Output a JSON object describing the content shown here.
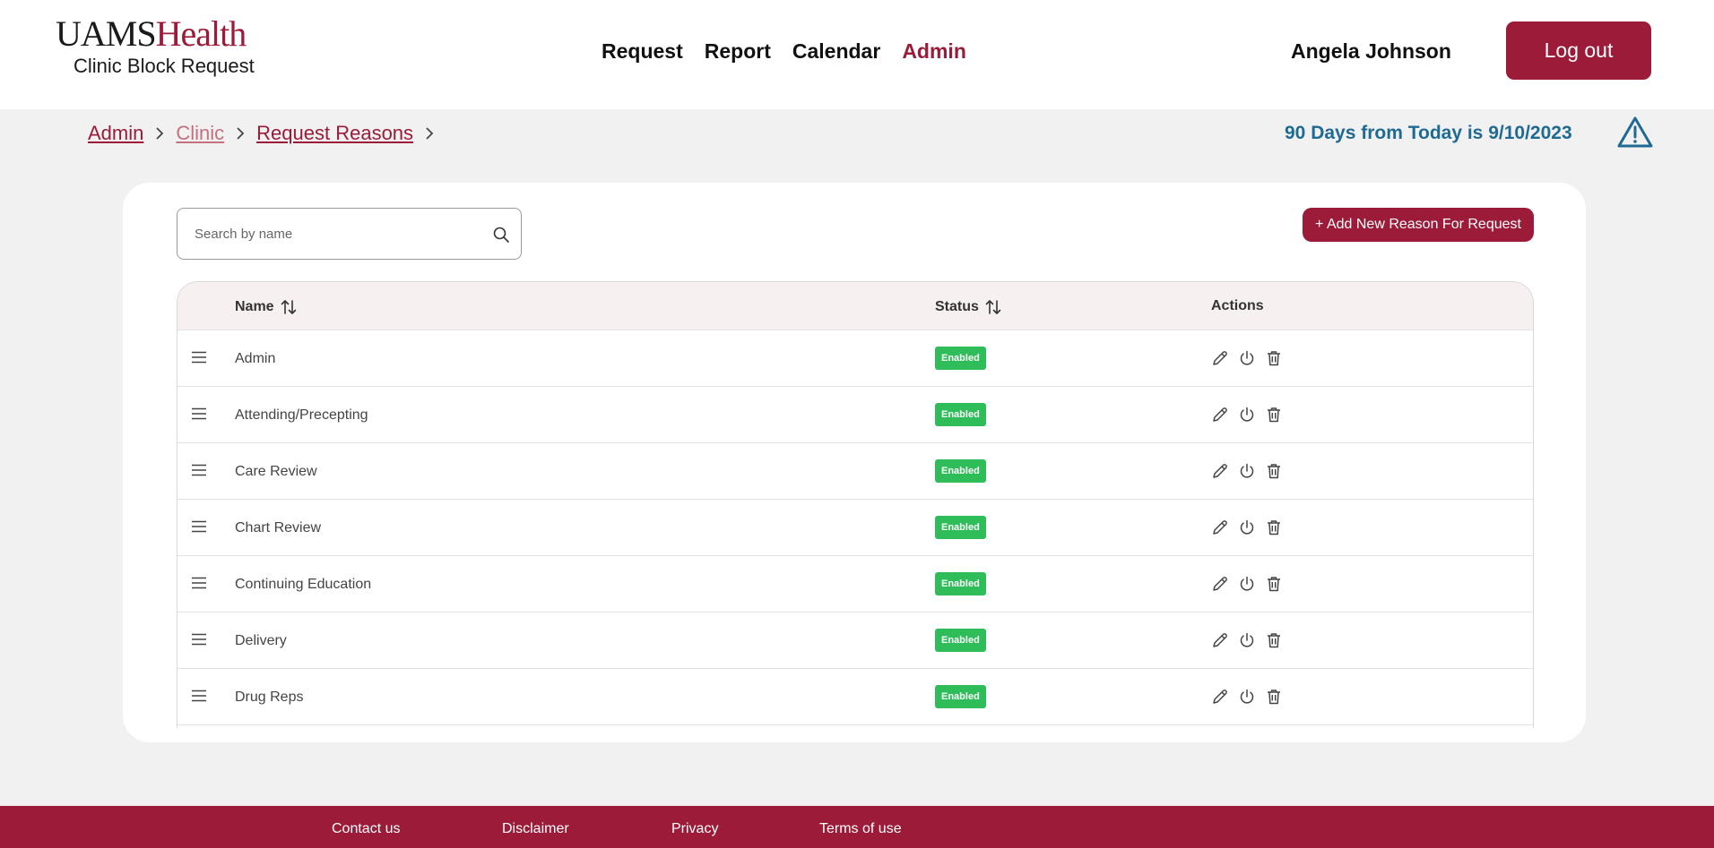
{
  "header": {
    "logo_uams": "UAMS",
    "logo_health": "Health",
    "logo_subtitle": "Clinic Block Request",
    "nav": [
      "Request",
      "Report",
      "Calendar",
      "Admin"
    ],
    "active_nav": "Admin",
    "user_name": "Angela Johnson",
    "logout_label": "Log out"
  },
  "breadcrumb": [
    "Admin",
    "Clinic",
    "Request Reasons"
  ],
  "days_note": "90 Days from Today is 9/10/2023",
  "search": {
    "placeholder": "Search by name",
    "value": ""
  },
  "add_button_label": "+ Add New Reason For Request",
  "table": {
    "columns": {
      "name": "Name",
      "status": "Status",
      "actions": "Actions"
    },
    "rows": [
      {
        "name": "Admin",
        "status": "Enabled"
      },
      {
        "name": "Attending/Precepting",
        "status": "Enabled"
      },
      {
        "name": "Care Review",
        "status": "Enabled"
      },
      {
        "name": "Chart Review",
        "status": "Enabled"
      },
      {
        "name": "Continuing Education",
        "status": "Enabled"
      },
      {
        "name": "Delivery",
        "status": "Enabled"
      },
      {
        "name": "Drug Reps",
        "status": "Enabled"
      }
    ]
  },
  "footer": [
    "Contact us",
    "Disclaimer",
    "Privacy",
    "Terms of use"
  ],
  "colors": {
    "brand": "#9b1b38",
    "enabled_badge": "#2ebd58",
    "info_text": "#1f6a93",
    "page_bg": "#f1f1f1"
  },
  "icons": [
    "search-icon",
    "warning-icon",
    "sort-icon",
    "drag-handle-icon",
    "edit-icon",
    "power-icon",
    "trash-icon",
    "chevron-right-icon"
  ]
}
